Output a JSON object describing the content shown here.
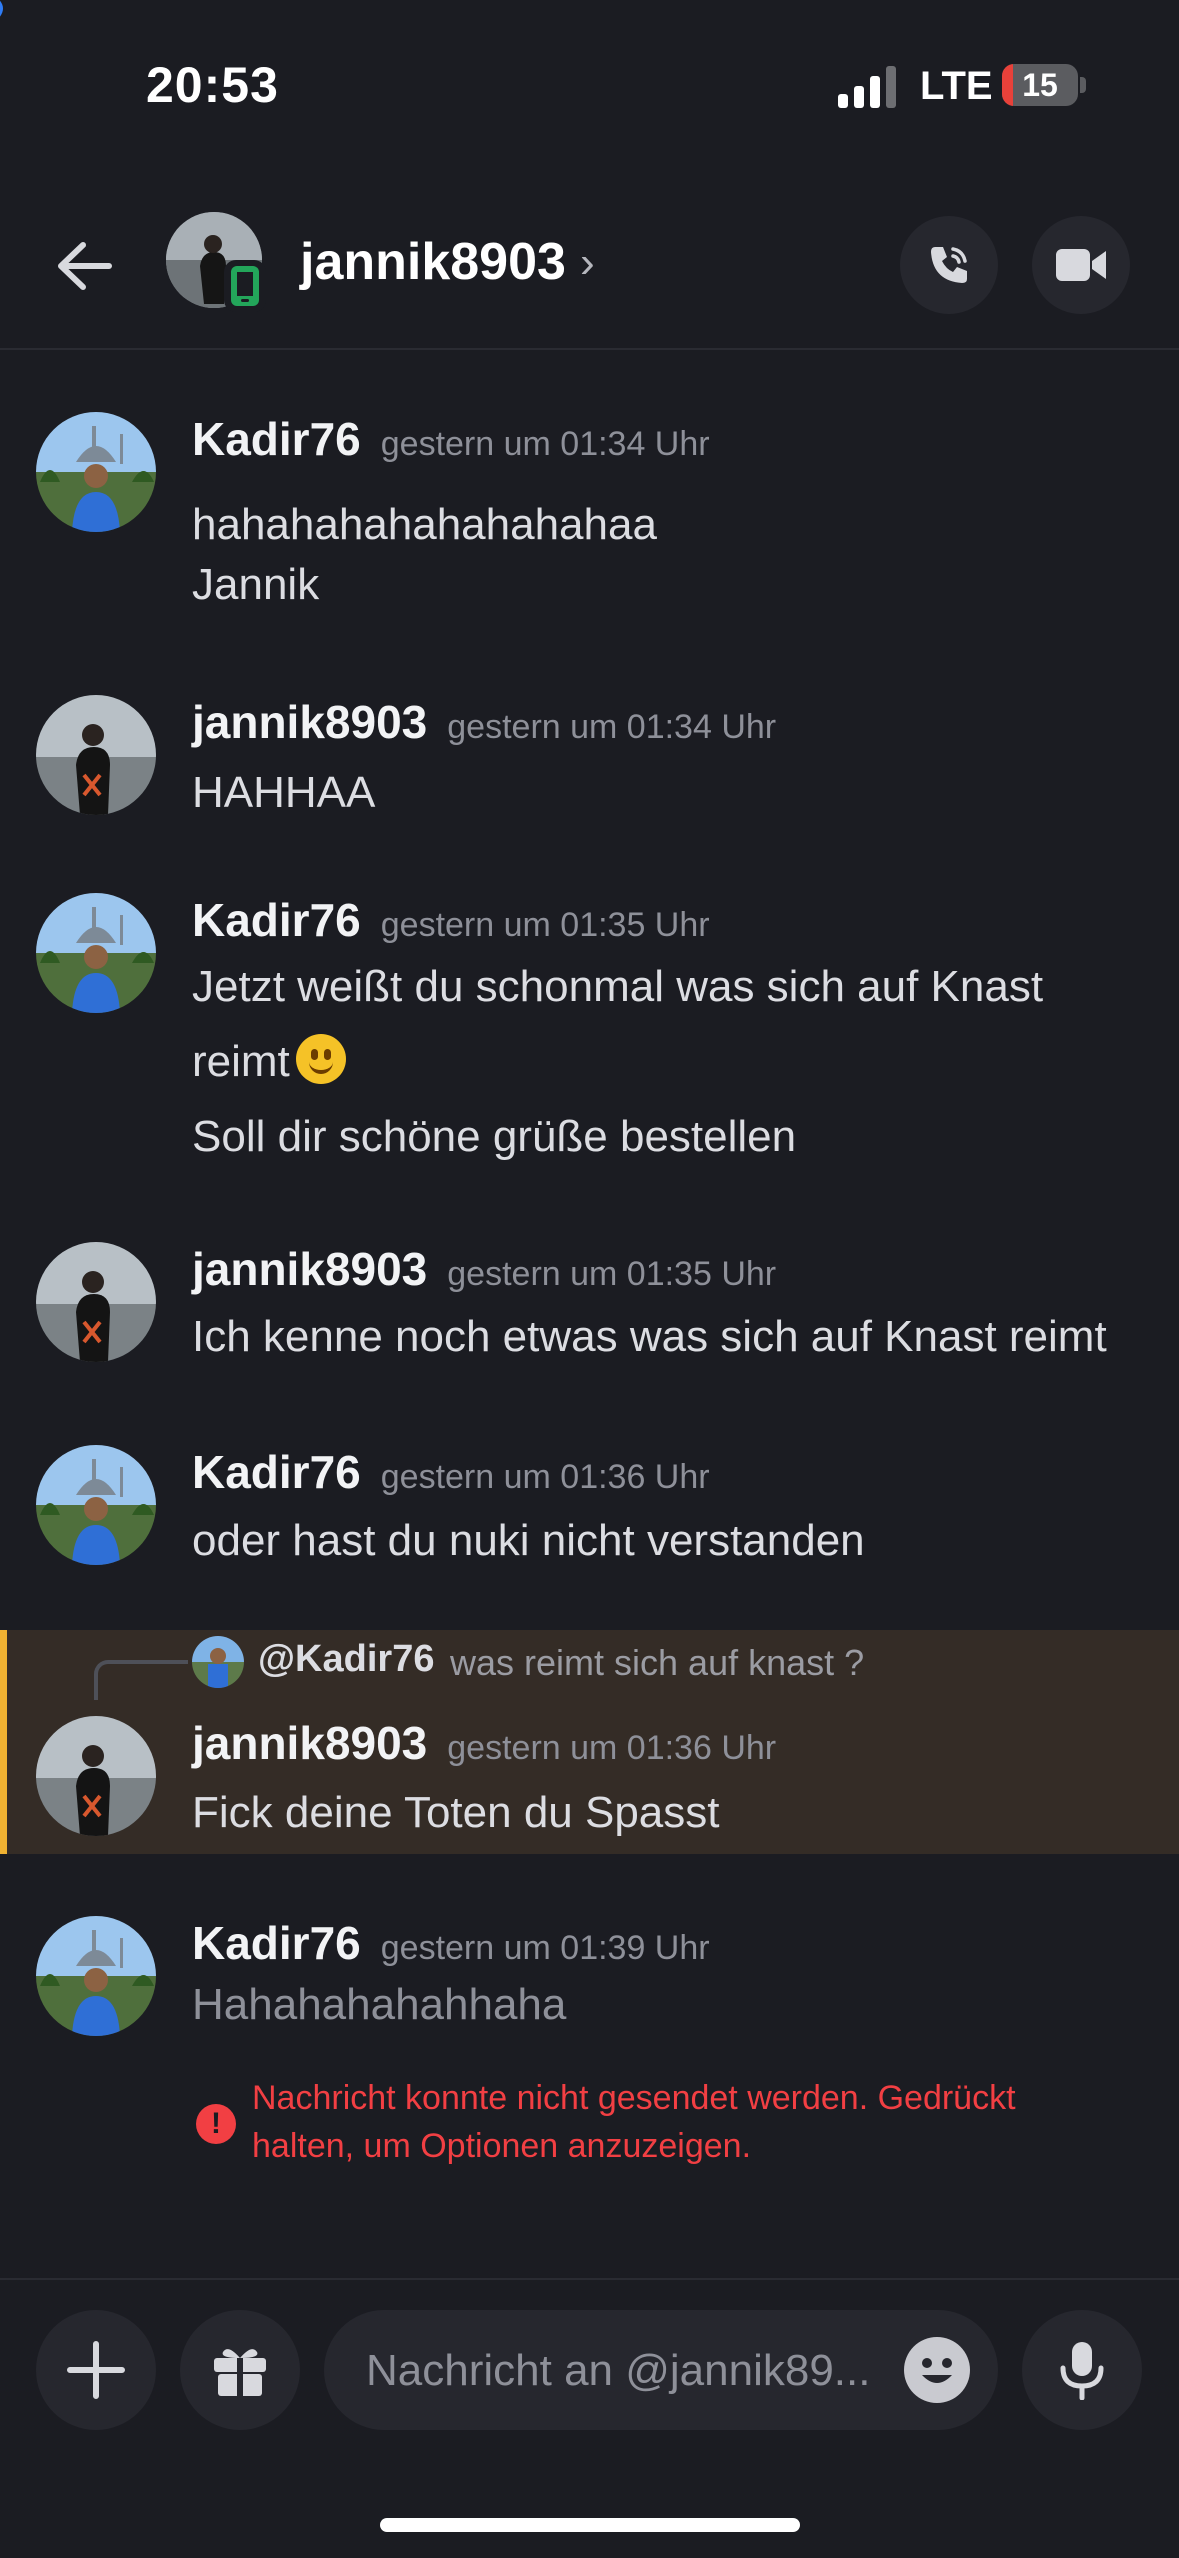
{
  "status_bar": {
    "time": "20:53",
    "network": "LTE",
    "battery": "15",
    "battery_level_percent": 15
  },
  "header": {
    "username": "jannik8903",
    "chevron": "›"
  },
  "messages": [
    {
      "author": "Kadir76",
      "time": "gestern um 01:34 Uhr",
      "lines": [
        "hahahahahahahahahaa",
        "Jannik"
      ]
    },
    {
      "author": "jannik8903",
      "time": "gestern um 01:34 Uhr",
      "lines": [
        "HAHHAA"
      ]
    },
    {
      "author": "Kadir76",
      "time": "gestern um 01:35 Uhr",
      "lines": [
        "Jetzt weißt du schonmal was sich auf Knast",
        "reimt",
        "Soll dir schöne grüße bestellen"
      ]
    },
    {
      "author": "jannik8903",
      "time": "gestern um 01:35 Uhr",
      "lines": [
        "Ich kenne noch etwas was sich auf Knast reimt"
      ]
    },
    {
      "author": "Kadir76",
      "time": "gestern um 01:36 Uhr",
      "lines": [
        "oder hast du nuki nicht verstanden"
      ]
    },
    {
      "author": "jannik8903",
      "time": "gestern um 01:36 Uhr",
      "lines": [
        "Fick deine Toten du Spasst"
      ],
      "reply": {
        "mention": "@Kadir76",
        "text": "was reimt sich auf knast ?"
      }
    },
    {
      "author": "Kadir76",
      "time": "gestern um 01:39 Uhr",
      "lines": [
        "Hahahahahahhaha"
      ],
      "error": "Nachricht konnte nicht gesendet werden. Gedrückt halten, um Optionen anzuzeigen."
    }
  ],
  "composer": {
    "placeholder": "Nachricht an @jannik89..."
  },
  "colors": {
    "background": "#1b1c22",
    "error": "#f23f43",
    "highlight": "#342c26",
    "highlight_bar": "#f0b232",
    "online_mobile": "#23a55a"
  }
}
